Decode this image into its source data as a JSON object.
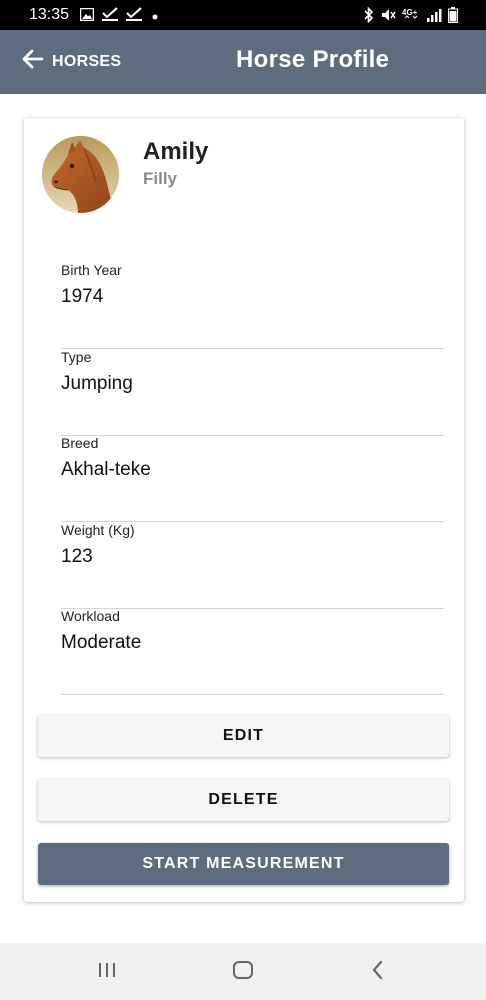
{
  "status_bar": {
    "time": "13:35",
    "left_icons": [
      "image-icon",
      "check-icon",
      "check-icon",
      "dot-icon"
    ],
    "right_icons": [
      "bluetooth-icon",
      "mute-icon",
      "4g-icon",
      "signal-icon",
      "battery-icon"
    ],
    "network_label": "4G+"
  },
  "app_bar": {
    "back_label": "HORSES",
    "title": "Horse Profile",
    "color": "#5d6c7e"
  },
  "horse": {
    "name": "Amily",
    "class": "Filly"
  },
  "fields": [
    {
      "label": "Birth Year",
      "value": "1974"
    },
    {
      "label": "Type",
      "value": "Jumping"
    },
    {
      "label": "Breed",
      "value": "Akhal-teke"
    },
    {
      "label": "Weight (Kg)",
      "value": "123"
    },
    {
      "label": "Workload",
      "value": "Moderate"
    }
  ],
  "actions": {
    "edit": "EDIT",
    "delete": "DELETE",
    "start": "START MEASUREMENT"
  },
  "nav": {
    "icons": [
      "recent-apps-icon",
      "home-icon",
      "back-icon"
    ]
  }
}
